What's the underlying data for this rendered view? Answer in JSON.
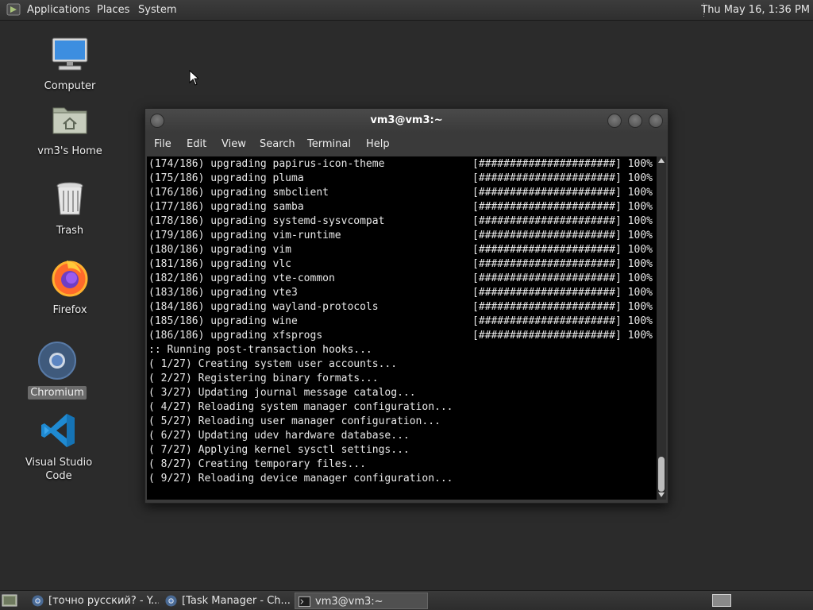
{
  "top_panel": {
    "menus": [
      "Applications",
      "Places",
      "System"
    ],
    "clock": "Thu May 16,  1:36 PM"
  },
  "desktop": {
    "icons": [
      {
        "label": "Computer",
        "icon": "computer-icon"
      },
      {
        "label": "vm3's Home",
        "icon": "home-folder-icon"
      },
      {
        "label": "Trash",
        "icon": "trash-icon"
      },
      {
        "label": "Firefox",
        "icon": "firefox-icon"
      },
      {
        "label": "Chromium",
        "icon": "chromium-icon",
        "selected": true
      },
      {
        "label": "Visual Studio Code",
        "icon": "vscode-icon"
      }
    ]
  },
  "terminal": {
    "title": "vm3@vm3:~",
    "menu": [
      "File",
      "Edit",
      "View",
      "Search",
      "Terminal",
      "Help"
    ],
    "lines": [
      {
        "text": "(174/186) upgrading papirus-icon-theme",
        "bar": "[######################] 100%"
      },
      {
        "text": "(175/186) upgrading pluma",
        "bar": "[######################] 100%"
      },
      {
        "text": "(176/186) upgrading smbclient",
        "bar": "[######################] 100%"
      },
      {
        "text": "(177/186) upgrading samba",
        "bar": "[######################] 100%"
      },
      {
        "text": "(178/186) upgrading systemd-sysvcompat",
        "bar": "[######################] 100%"
      },
      {
        "text": "(179/186) upgrading vim-runtime",
        "bar": "[######################] 100%"
      },
      {
        "text": "(180/186) upgrading vim",
        "bar": "[######################] 100%"
      },
      {
        "text": "(181/186) upgrading vlc",
        "bar": "[######################] 100%"
      },
      {
        "text": "(182/186) upgrading vte-common",
        "bar": "[######################] 100%"
      },
      {
        "text": "(183/186) upgrading vte3",
        "bar": "[######################] 100%"
      },
      {
        "text": "(184/186) upgrading wayland-protocols",
        "bar": "[######################] 100%"
      },
      {
        "text": "(185/186) upgrading wine",
        "bar": "[######################] 100%"
      },
      {
        "text": "(186/186) upgrading xfsprogs",
        "bar": "[######################] 100%"
      },
      {
        "text": ":: Running post-transaction hooks...",
        "bar": ""
      },
      {
        "text": "( 1/27) Creating system user accounts...",
        "bar": ""
      },
      {
        "text": "( 2/27) Registering binary formats...",
        "bar": ""
      },
      {
        "text": "( 3/27) Updating journal message catalog...",
        "bar": ""
      },
      {
        "text": "( 4/27) Reloading system manager configuration...",
        "bar": ""
      },
      {
        "text": "( 5/27) Reloading user manager configuration...",
        "bar": ""
      },
      {
        "text": "( 6/27) Updating udev hardware database...",
        "bar": ""
      },
      {
        "text": "( 7/27) Applying kernel sysctl settings...",
        "bar": ""
      },
      {
        "text": "( 8/27) Creating temporary files...",
        "bar": ""
      },
      {
        "text": "( 9/27) Reloading device manager configuration...",
        "bar": ""
      }
    ]
  },
  "taskbar": {
    "tasks": [
      {
        "label": "[точно русский? - Y...",
        "icon": "chromium-icon",
        "active": false
      },
      {
        "label": "[Task Manager - Ch...",
        "icon": "chromium-icon",
        "active": false
      },
      {
        "label": "vm3@vm3:~",
        "icon": "terminal-icon",
        "active": true
      }
    ]
  }
}
